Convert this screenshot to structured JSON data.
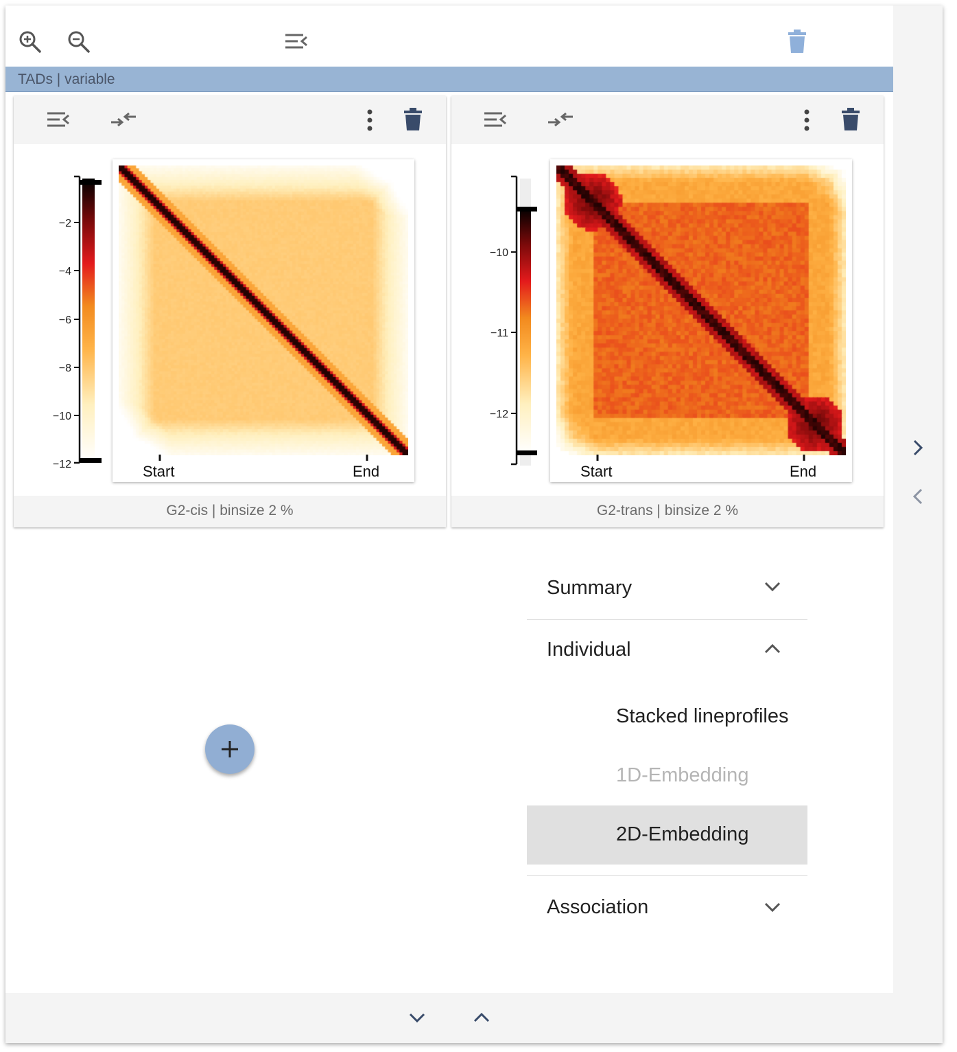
{
  "toolbar": {
    "zoom_in": "zoom-in-icon",
    "zoom_out": "zoom-out-icon",
    "menu": "menu-collapse-icon",
    "delete": "trash-icon"
  },
  "dataset": {
    "label": "TADs | variable"
  },
  "widgets": [
    {
      "footer": "G2-cis | binsize 2 %",
      "x_ticks": [
        "Start",
        "End"
      ],
      "colorbar_ticks": [
        "−2",
        "−4",
        "−6",
        "−8",
        "−10",
        "−12"
      ]
    },
    {
      "footer": "G2-trans | binsize 2 %",
      "x_ticks": [
        "Start",
        "End"
      ],
      "colorbar_ticks": [
        "−10",
        "−11",
        "−12"
      ]
    }
  ],
  "chart_data": [
    {
      "type": "heatmap",
      "title": "",
      "xlabel": "",
      "ylabel": "",
      "x_ticks": [
        "Start",
        "End"
      ],
      "colorbar_range": [
        -12,
        -0.3
      ],
      "colorbar_ticks": [
        -2,
        -4,
        -6,
        -8,
        -10,
        -12
      ],
      "colormap": "fall",
      "pattern": "sharp diagonal maximum, weak TAD borders"
    },
    {
      "type": "heatmap",
      "title": "",
      "xlabel": "",
      "ylabel": "",
      "x_ticks": [
        "Start",
        "End"
      ],
      "colorbar_range": [
        -12.6,
        -9.6
      ],
      "colorbar_ticks": [
        -10,
        -11,
        -12
      ],
      "colormap": "fall",
      "pattern": "strong TAD box with corner enrichment"
    }
  ],
  "menu": {
    "summary": "Summary",
    "individual": "Individual",
    "items": [
      "Stacked lineprofiles",
      "1D-Embedding",
      "2D-Embedding"
    ],
    "association": "Association"
  },
  "colors": {
    "accent": "#98b4d4",
    "icon": "#394b6a",
    "fab": "#91aed3"
  }
}
